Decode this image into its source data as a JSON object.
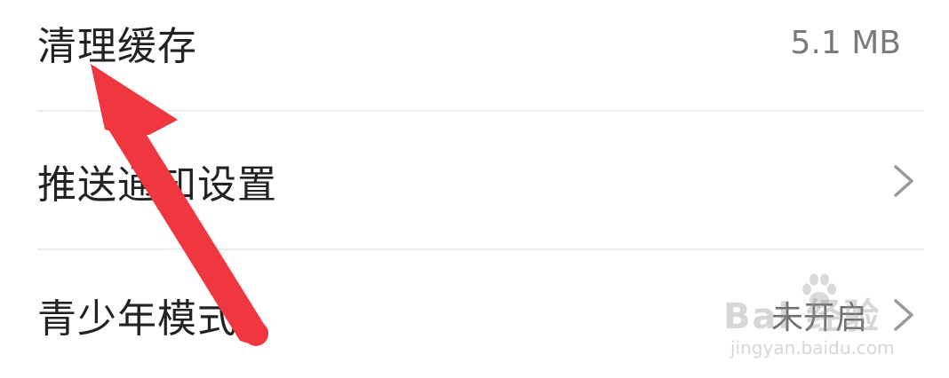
{
  "settings": {
    "items": [
      {
        "label": "清理缓存",
        "value": "5.1 MB",
        "has_chevron": false
      },
      {
        "label": "推送通知设置",
        "value": "",
        "has_chevron": true
      },
      {
        "label": "青少年模式",
        "value": "未开启",
        "has_chevron": true
      }
    ]
  },
  "watermark": {
    "brand": "Bai 经验",
    "subtext": "jingyan.baidu.com"
  },
  "colors": {
    "arrow": "#f0363f",
    "label_text": "#222222",
    "value_text": "#7a7a7a",
    "divider": "#ececec"
  },
  "icons": {
    "chevron": "chevron-right-icon",
    "annotation": "red-arrow-annotation"
  }
}
